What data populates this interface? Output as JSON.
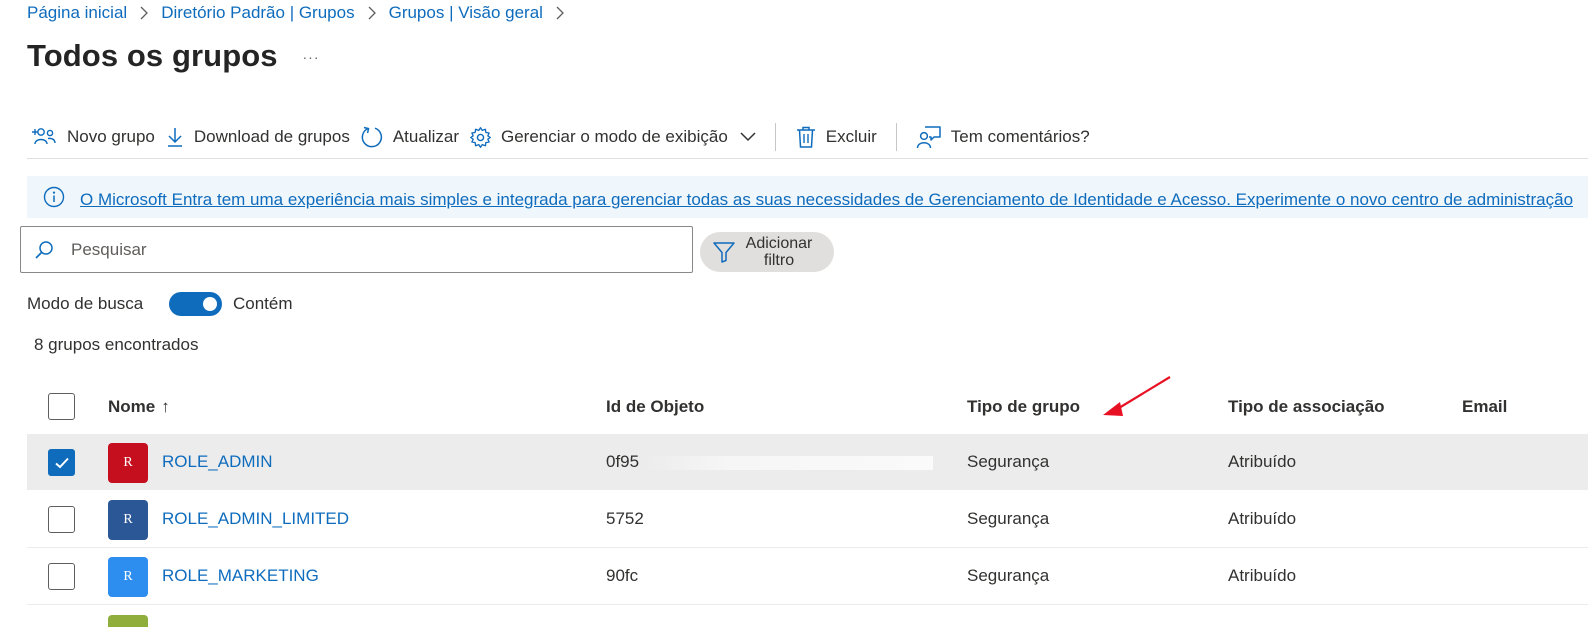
{
  "breadcrumb": [
    {
      "label": "Página inicial"
    },
    {
      "label": "Diretório Padrão | Grupos"
    },
    {
      "label": "Grupos | Visão geral"
    }
  ],
  "page": {
    "title": "Todos os grupos",
    "more": "···"
  },
  "toolbar": {
    "new_group": "Novo grupo",
    "download": "Download de grupos",
    "refresh": "Atualizar",
    "manage_view": "Gerenciar o modo de exibição",
    "delete": "Excluir",
    "feedback": "Tem comentários?"
  },
  "banner": {
    "text": "O Microsoft Entra tem uma experiência mais simples e integrada para gerenciar todas as suas necessidades de Gerenciamento de Identidade e Acesso. Experimente o novo centro de administração"
  },
  "search": {
    "placeholder": "Pesquisar",
    "value": ""
  },
  "filter": {
    "label": "Adicionar filtro"
  },
  "search_mode": {
    "label": "Modo de busca",
    "value": "Contém",
    "enabled": true
  },
  "result_count": "8 grupos encontrados",
  "table": {
    "columns": {
      "name": "Nome",
      "sort_indicator": "↑",
      "object_id": "Id de Objeto",
      "group_type": "Tipo de grupo",
      "membership_type": "Tipo de associação",
      "email": "Email"
    },
    "rows": [
      {
        "initial": "R",
        "avatar_color": "#c50f1f",
        "name": "ROLE_ADMIN",
        "object_id_visible": "0f95",
        "group_type": "Segurança",
        "membership_type": "Atribuído",
        "email": "",
        "selected": true
      },
      {
        "initial": "R",
        "avatar_color": "#2b5797",
        "name": "ROLE_ADMIN_LIMITED",
        "object_id_visible": "5752",
        "group_type": "Segurança",
        "membership_type": "Atribuído",
        "email": "",
        "selected": false
      },
      {
        "initial": "R",
        "avatar_color": "#2d8ef0",
        "name": "ROLE_MARKETING",
        "object_id_visible": "90fc",
        "group_type": "Segurança",
        "membership_type": "Atribuído",
        "email": "",
        "selected": false
      }
    ]
  },
  "colors": {
    "accent": "#0f6cbd",
    "annotation_arrow": "#e81123",
    "banner_bg": "#eff6fc",
    "selected_row": "#ececec"
  }
}
